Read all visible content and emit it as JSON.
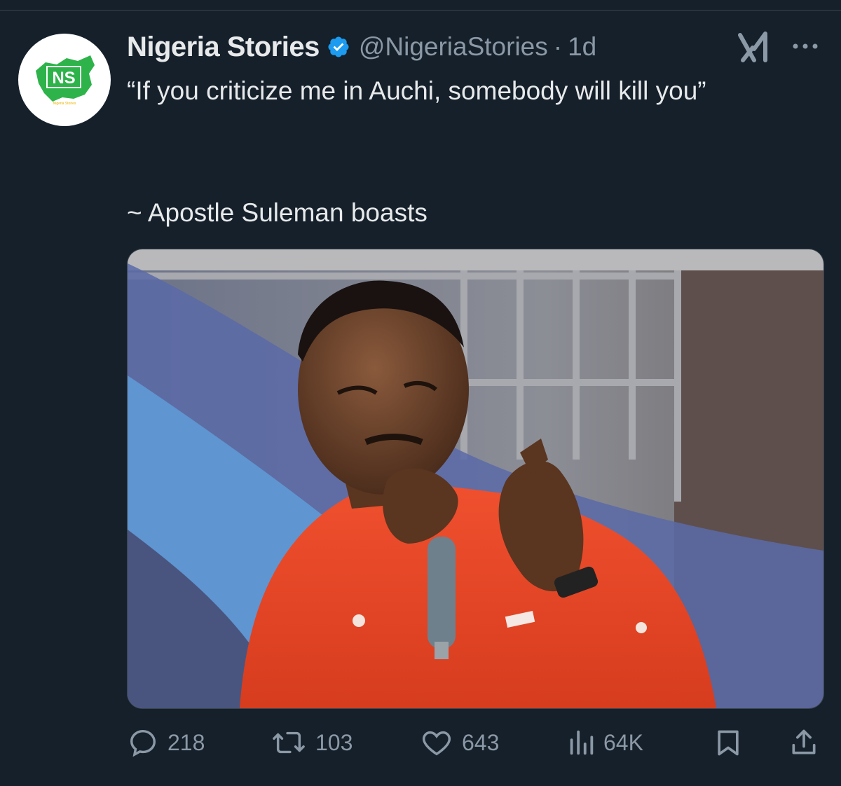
{
  "tweet": {
    "author": {
      "display_name": "Nigeria Stories",
      "handle": "@NigeriaStories",
      "separator": "·",
      "time": "1d",
      "verified": true,
      "avatar_text": "NS",
      "avatar_caption": "Nigeria Stories"
    },
    "text": "“If you criticize me in Auchi, somebody will kill you”",
    "attribution": "~  Apostle Suleman boasts",
    "media": {
      "kind": "photo",
      "icon": "photo-man-with-microphone"
    },
    "actions": {
      "reply": {
        "icon": "reply-icon",
        "count": "218"
      },
      "retweet": {
        "icon": "retweet-icon",
        "count": "103"
      },
      "like": {
        "icon": "heart-icon",
        "count": "643"
      },
      "views": {
        "icon": "views-icon",
        "count": "64K"
      },
      "bookmark": {
        "icon": "bookmark-icon"
      },
      "share": {
        "icon": "share-icon"
      }
    },
    "header_icons": [
      "grok-icon",
      "more-icon"
    ]
  },
  "colors": {
    "background": "#15202b",
    "text": "#e7e9ea",
    "muted": "#8b98a5",
    "verified": "#1d9bf0",
    "brand_green": "#2db34a"
  }
}
